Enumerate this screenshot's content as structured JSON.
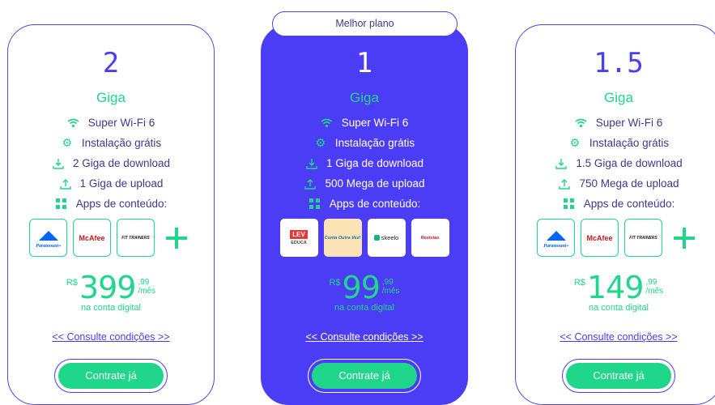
{
  "badge": "Melhor plano",
  "plans": [
    {
      "speed": "2",
      "unit": "Giga",
      "features": [
        "Super Wi-Fi 6",
        "Instalação grátis",
        "2 Giga de download",
        "1 Giga de upload",
        "Apps de conteúdo:"
      ],
      "apps": [
        "Paramount+",
        "McAfee",
        "FIT TRAINERS"
      ],
      "currency": "R$",
      "price": "399",
      "cents": ",99",
      "period": "/mês",
      "note": "na conta digital",
      "conditions": "<< Consulte condições >>",
      "cta": "Contrate já"
    },
    {
      "speed": "1",
      "unit": "Giga",
      "features": [
        "Super Wi-Fi 6",
        "Instalação grátis",
        "1 Giga de download",
        "500 Mega de upload",
        "Apps de conteúdo:"
      ],
      "apps": [
        "LEV EDUCA",
        "Conta Outra Vez!",
        "skeelo",
        "Revistas"
      ],
      "currency": "R$",
      "price": "99",
      "cents": ",99",
      "period": "/mês",
      "note": "na conta digital",
      "conditions": "<< Consulte condições >>",
      "cta": "Contrate já"
    },
    {
      "speed": "1.5",
      "unit": "Giga",
      "features": [
        "Super Wi-Fi 6",
        "Instalação grátis",
        "1.5 Giga de download",
        "750 Mega de upload",
        "Apps de conteúdo:"
      ],
      "apps": [
        "Paramount+",
        "McAfee",
        "FIT TRAINERS"
      ],
      "currency": "R$",
      "price": "149",
      "cents": ",99",
      "period": "/mês",
      "note": "na conta digital",
      "conditions": "<< Consulte condições >>",
      "cta": "Contrate já"
    }
  ],
  "colors": {
    "brand": "#4a3df5",
    "accent": "#1fd68a",
    "text": "#3d3a8c"
  },
  "icons": [
    "wifi-icon",
    "gear-icon",
    "download-icon",
    "upload-icon",
    "apps-grid-icon",
    "plus-icon"
  ]
}
